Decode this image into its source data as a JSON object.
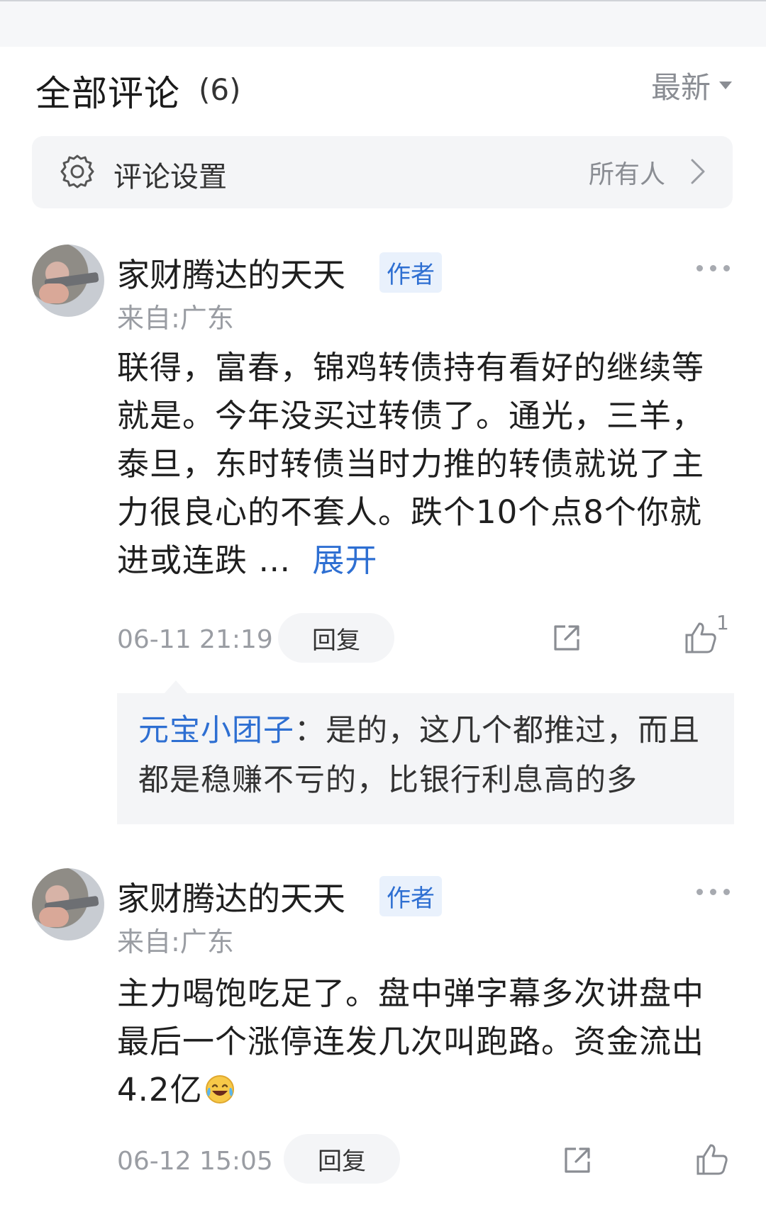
{
  "header": {
    "title": "全部评论",
    "count": "(6)",
    "sort_label": "最新"
  },
  "settings": {
    "label": "评论设置",
    "value": "所有人"
  },
  "comments": [
    {
      "username": "家财腾达的天天",
      "badge": "作者",
      "location": "来自:广东",
      "text": "联得，富春，锦鸡转债持有看好的继续等就是。今年没买过转债了。通光，三羊，泰旦，东时转债当时力推的转债就说了主力很良心的不套人。跌个10个点8个你就进或连跌 …",
      "expand_label": "展开",
      "time": "06-11 21:19",
      "reply_label": "回复",
      "like_count": "1",
      "sub_reply": {
        "user": "元宝小团子",
        "separator": "：",
        "text": "是的，这几个都推过，而且都是稳赚不亏的，比银行利息高的多"
      }
    },
    {
      "username": "家财腾达的天天",
      "badge": "作者",
      "location": "来自:广东",
      "text": "主力喝饱吃足了。盘中弹字幕多次讲盘中最后一个涨停连发几次叫跑路。资金流出4.2亿",
      "emoji": "laughing-crying-emoji",
      "time": "06-12 15:05",
      "reply_label": "回复",
      "like_count": ""
    }
  ],
  "colors": {
    "accent_blue": "#2e6fd2",
    "muted_gray": "#9a9da3",
    "panel_bg": "#f4f5f7"
  }
}
